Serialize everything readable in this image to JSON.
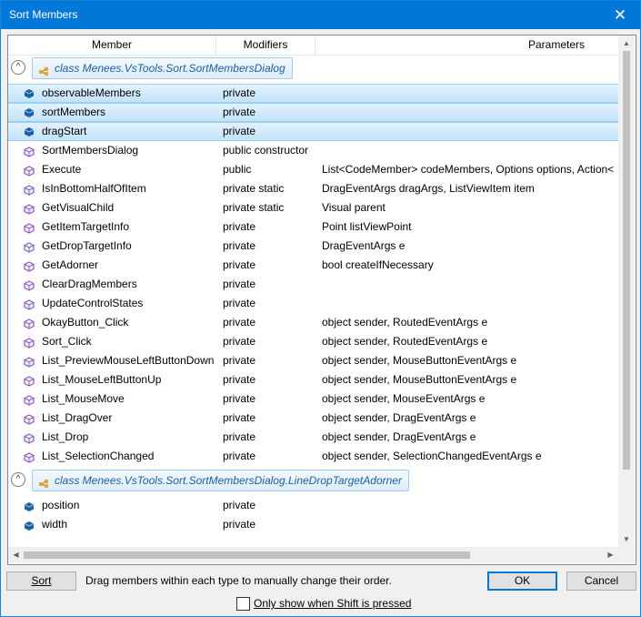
{
  "window": {
    "title": "Sort Members",
    "close_glyph": "✕"
  },
  "columns": [
    "Member",
    "Modifiers",
    "Parameters"
  ],
  "groups": [
    {
      "label": "class Menees.VsTools.Sort.SortMembersDialog",
      "expander": "^",
      "rows": [
        {
          "name": "observableMembers",
          "modifiers": "private",
          "params": "",
          "kind": "field",
          "selected": true
        },
        {
          "name": "sortMembers",
          "modifiers": "private",
          "params": "",
          "kind": "field",
          "selected": true
        },
        {
          "name": "dragStart",
          "modifiers": "private",
          "params": "",
          "kind": "field",
          "selected": true
        },
        {
          "name": "SortMembersDialog",
          "modifiers": "public constructor",
          "params": "",
          "kind": "method",
          "selected": false
        },
        {
          "name": "Execute",
          "modifiers": "public",
          "params": "List<CodeMember> codeMembers, Options options, Action<",
          "kind": "method",
          "selected": false
        },
        {
          "name": "IsInBottomHalfOfItem",
          "modifiers": "private static",
          "params": "DragEventArgs dragArgs, ListViewItem item",
          "kind": "method",
          "selected": false
        },
        {
          "name": "GetVisualChild",
          "modifiers": "private static",
          "params": "Visual parent",
          "kind": "method",
          "selected": false
        },
        {
          "name": "GetItemTargetInfo",
          "modifiers": "private",
          "params": "Point listViewPoint",
          "kind": "method",
          "selected": false
        },
        {
          "name": "GetDropTargetInfo",
          "modifiers": "private",
          "params": "DragEventArgs e",
          "kind": "method",
          "selected": false
        },
        {
          "name": "GetAdorner",
          "modifiers": "private",
          "params": "bool createIfNecessary",
          "kind": "method",
          "selected": false
        },
        {
          "name": "ClearDragMembers",
          "modifiers": "private",
          "params": "",
          "kind": "method",
          "selected": false
        },
        {
          "name": "UpdateControlStates",
          "modifiers": "private",
          "params": "",
          "kind": "method",
          "selected": false
        },
        {
          "name": "OkayButton_Click",
          "modifiers": "private",
          "params": "object sender, RoutedEventArgs e",
          "kind": "method",
          "selected": false
        },
        {
          "name": "Sort_Click",
          "modifiers": "private",
          "params": "object sender, RoutedEventArgs e",
          "kind": "method",
          "selected": false
        },
        {
          "name": "List_PreviewMouseLeftButtonDown",
          "modifiers": "private",
          "params": "object sender, MouseButtonEventArgs e",
          "kind": "method",
          "selected": false
        },
        {
          "name": "List_MouseLeftButtonUp",
          "modifiers": "private",
          "params": "object sender, MouseButtonEventArgs e",
          "kind": "method",
          "selected": false
        },
        {
          "name": "List_MouseMove",
          "modifiers": "private",
          "params": "object sender, MouseEventArgs e",
          "kind": "method",
          "selected": false
        },
        {
          "name": "List_DragOver",
          "modifiers": "private",
          "params": "object sender, DragEventArgs e",
          "kind": "method",
          "selected": false
        },
        {
          "name": "List_Drop",
          "modifiers": "private",
          "params": "object sender, DragEventArgs e",
          "kind": "method",
          "selected": false
        },
        {
          "name": "List_SelectionChanged",
          "modifiers": "private",
          "params": "object sender, SelectionChangedEventArgs e",
          "kind": "method",
          "selected": false
        }
      ]
    },
    {
      "label": "class Menees.VsTools.Sort.SortMembersDialog.LineDropTargetAdorner",
      "expander": "^",
      "rows": [
        {
          "name": "position",
          "modifiers": "private",
          "params": "",
          "kind": "field",
          "selected": false
        },
        {
          "name": "width",
          "modifiers": "private",
          "params": "",
          "kind": "field",
          "selected": false
        }
      ]
    }
  ],
  "footer": {
    "sort_button": "Sort",
    "hint": "Drag members within each type to manually change their order.",
    "ok_button": "OK",
    "cancel_button": "Cancel",
    "checkbox_label": "Only show when Shift is pressed",
    "checkbox_checked": false
  },
  "colors": {
    "accent": "#0078d7",
    "selection": "#cce8ff",
    "class_text": "#1b5fa0",
    "method_icon": "#8a5fb5",
    "field_icon": "#1f5fa6"
  }
}
